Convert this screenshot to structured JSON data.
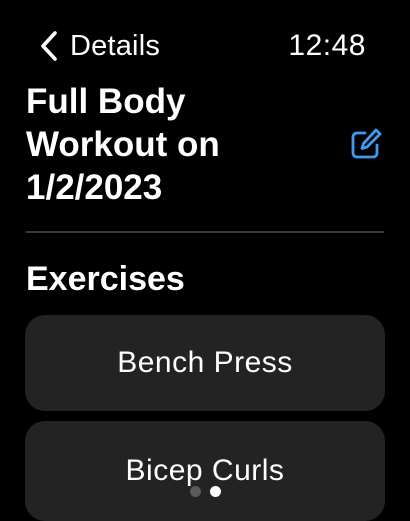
{
  "header": {
    "back_label": "Details",
    "time": "12:48"
  },
  "workout": {
    "title": "Full Body Workout on 1/2/2023"
  },
  "exercises": {
    "heading": "Exercises",
    "items": [
      {
        "name": "Bench Press"
      },
      {
        "name": "Bicep Curls"
      }
    ]
  },
  "page_indicator": {
    "total": 2,
    "current": 2
  },
  "colors": {
    "background": "#000000",
    "card": "#232323",
    "accent": "#3d9cf0",
    "divider": "#3a3a3c",
    "dot_active": "#ffffff",
    "dot_inactive": "#5a5a5a"
  }
}
